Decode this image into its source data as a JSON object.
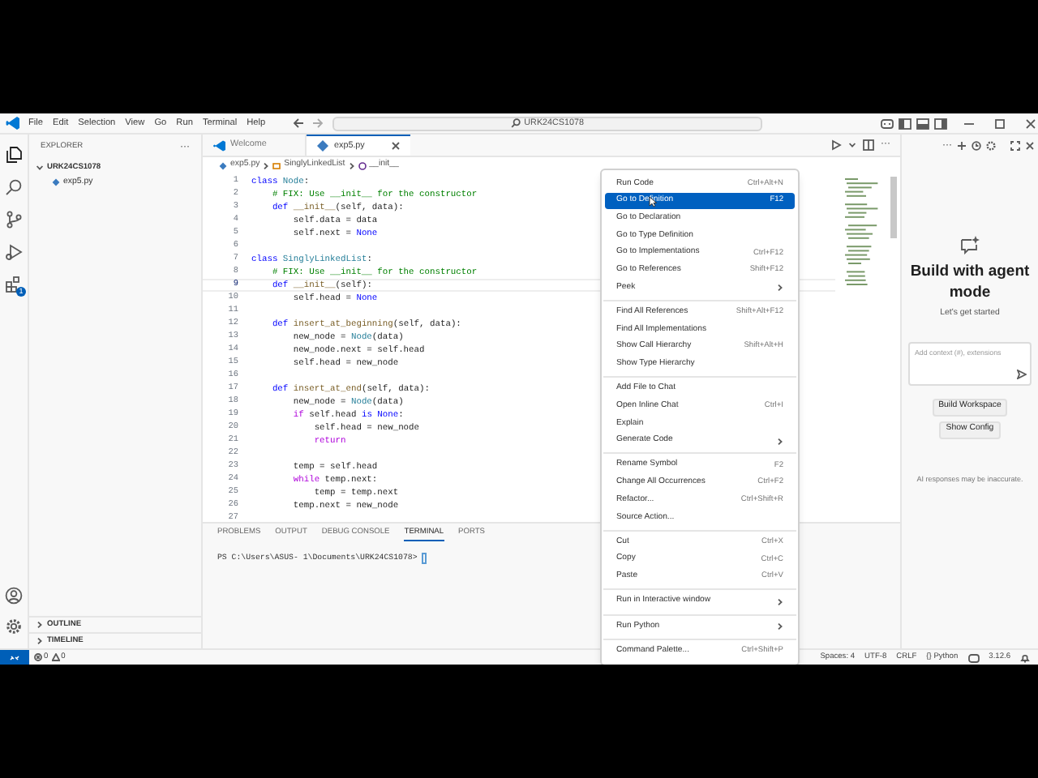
{
  "title_bar": {
    "menus": [
      "File",
      "Edit",
      "Selection",
      "View",
      "Go",
      "Run",
      "Terminal",
      "Help"
    ],
    "search": "URK24CS1078"
  },
  "activity_bar": {
    "extensions_badge": "1"
  },
  "sidebar": {
    "title": "EXPLORER",
    "more": "···",
    "folder": {
      "name": "URK24CS1078",
      "expanded": true,
      "files": [
        {
          "name": "exp5.py"
        }
      ]
    },
    "sections": [
      {
        "name": "OUTLINE",
        "expanded": false
      },
      {
        "name": "TIMELINE",
        "expanded": false
      }
    ]
  },
  "tabs": [
    {
      "label": "Welcome",
      "kind": "welcome",
      "selected": false
    },
    {
      "label": "exp5.py",
      "kind": "python",
      "selected": true
    }
  ],
  "breadcrumb": [
    "exp5.py",
    "SinglyLinkedList",
    "__init__"
  ],
  "editor": {
    "lines": [
      {
        "number": "1",
        "active": false,
        "segments": [
          {
            "kind": "keyword",
            "text": "class"
          },
          {
            "kind": "class",
            "text": " Node"
          },
          {
            "kind": "plain",
            "text": ":"
          }
        ]
      },
      {
        "number": "2",
        "active": false,
        "segments": [
          {
            "kind": "comment",
            "text": "    # FIX: Use __init__ for the constructor"
          }
        ]
      },
      {
        "number": "3",
        "active": false,
        "segments": [
          {
            "kind": "keyword",
            "text": "    def"
          },
          {
            "kind": "function",
            "text": " __init__"
          },
          {
            "kind": "plain",
            "text": "(self, data):"
          }
        ]
      },
      {
        "number": "4",
        "active": false,
        "segments": [
          {
            "kind": "plain",
            "text": "        self.data = data"
          }
        ]
      },
      {
        "number": "5",
        "active": false,
        "segments": [
          {
            "kind": "plain",
            "text": "        self.next = "
          },
          {
            "kind": "constant",
            "text": "None"
          }
        ]
      },
      {
        "number": "6",
        "active": false
      },
      {
        "number": "7",
        "active": false,
        "segments": [
          {
            "kind": "keyword",
            "text": "class"
          },
          {
            "kind": "class",
            "text": " SinglyLinkedList"
          },
          {
            "kind": "plain",
            "text": ":"
          }
        ]
      },
      {
        "number": "8",
        "active": false,
        "segments": [
          {
            "kind": "comment",
            "text": "    # FIX: Use __init__ for the constructor"
          }
        ]
      },
      {
        "number": "9",
        "active": true,
        "segments": [
          {
            "kind": "keyword",
            "text": "    def"
          },
          {
            "kind": "function",
            "text": " __init__"
          },
          {
            "kind": "plain",
            "text": "(self):"
          }
        ]
      },
      {
        "number": "10",
        "active": false,
        "segments": [
          {
            "kind": "plain",
            "text": "        self.head = "
          },
          {
            "kind": "constant",
            "text": "None"
          }
        ]
      },
      {
        "number": "11",
        "active": false
      },
      {
        "number": "12",
        "active": false,
        "segments": [
          {
            "kind": "keyword",
            "text": "    def"
          },
          {
            "kind": "function",
            "text": " insert_at_beginning"
          },
          {
            "kind": "plain",
            "text": "(self, data):"
          }
        ]
      },
      {
        "number": "13",
        "active": false,
        "segments": [
          {
            "kind": "plain",
            "text": "        new_node = "
          },
          {
            "kind": "class",
            "text": "Node"
          },
          {
            "kind": "plain",
            "text": "(data)"
          }
        ]
      },
      {
        "number": "14",
        "active": false,
        "segments": [
          {
            "kind": "plain",
            "text": "        new_node.next = self.head"
          }
        ]
      },
      {
        "number": "15",
        "active": false,
        "segments": [
          {
            "kind": "plain",
            "text": "        self.head = new_node"
          }
        ]
      },
      {
        "number": "16",
        "active": false
      },
      {
        "number": "17",
        "active": false,
        "segments": [
          {
            "kind": "keyword",
            "text": "    def"
          },
          {
            "kind": "function",
            "text": " insert_at_end"
          },
          {
            "kind": "plain",
            "text": "(self, data):"
          }
        ]
      },
      {
        "number": "18",
        "active": false,
        "segments": [
          {
            "kind": "plain",
            "text": "        new_node = "
          },
          {
            "kind": "class",
            "text": "Node"
          },
          {
            "kind": "plain",
            "text": "(data)"
          }
        ]
      },
      {
        "number": "19",
        "active": false,
        "segments": [
          {
            "kind": "control",
            "text": "        if"
          },
          {
            "kind": "plain",
            "text": " self.head "
          },
          {
            "kind": "keyword",
            "text": "is"
          },
          {
            "kind": "constant",
            "text": " None"
          },
          {
            "kind": "plain",
            "text": ":"
          }
        ]
      },
      {
        "number": "20",
        "active": false,
        "segments": [
          {
            "kind": "plain",
            "text": "            self.head = new_node"
          }
        ]
      },
      {
        "number": "21",
        "active": false,
        "segments": [
          {
            "kind": "control",
            "text": "            return"
          }
        ]
      },
      {
        "number": "22",
        "active": false
      },
      {
        "number": "23",
        "active": false,
        "segments": [
          {
            "kind": "plain",
            "text": "        temp = self.head"
          }
        ]
      },
      {
        "number": "24",
        "active": false,
        "segments": [
          {
            "kind": "control",
            "text": "        while"
          },
          {
            "kind": "plain",
            "text": " temp.next:"
          }
        ]
      },
      {
        "number": "25",
        "active": false,
        "segments": [
          {
            "kind": "plain",
            "text": "            temp = temp.next"
          }
        ]
      },
      {
        "number": "26",
        "active": false,
        "segments": [
          {
            "kind": "plain",
            "text": "        temp.next = new_node"
          }
        ]
      },
      {
        "number": "27",
        "active": false
      }
    ]
  },
  "panel": {
    "tabs": [
      {
        "label": "PROBLEMS",
        "selected": false
      },
      {
        "label": "OUTPUT",
        "selected": false
      },
      {
        "label": "DEBUG CONSOLE",
        "selected": false
      },
      {
        "label": "TERMINAL",
        "selected": true
      },
      {
        "label": "PORTS",
        "selected": false
      }
    ],
    "terminal": {
      "prompt": "PS C:\\Users\\ASUS- 1\\Documents\\URK24CS1078> "
    }
  },
  "context_menu": {
    "items": [
      {
        "kind": "item",
        "label": "Run Code",
        "shortcut": "Ctrl+Alt+N",
        "submenu": false,
        "selected": false
      },
      {
        "kind": "item",
        "label": "Go to Definition",
        "shortcut": "F12",
        "submenu": false,
        "selected": true
      },
      {
        "kind": "item",
        "label": "Go to Declaration",
        "submenu": false,
        "selected": false
      },
      {
        "kind": "item",
        "label": "Go to Type Definition",
        "submenu": false,
        "selected": false
      },
      {
        "kind": "item",
        "label": "Go to Implementations",
        "shortcut": "Ctrl+F12",
        "submenu": false,
        "selected": false
      },
      {
        "kind": "item",
        "label": "Go to References",
        "shortcut": "Shift+F12",
        "submenu": false,
        "selected": false
      },
      {
        "kind": "item",
        "label": "Peek",
        "submenu": true,
        "selected": false
      },
      {
        "kind": "separator"
      },
      {
        "kind": "item",
        "label": "Find All References",
        "shortcut": "Shift+Alt+F12",
        "submenu": false,
        "selected": false
      },
      {
        "kind": "item",
        "label": "Find All Implementations",
        "submenu": false,
        "selected": false
      },
      {
        "kind": "item",
        "label": "Show Call Hierarchy",
        "shortcut": "Shift+Alt+H",
        "submenu": false,
        "selected": false
      },
      {
        "kind": "item",
        "label": "Show Type Hierarchy",
        "submenu": false,
        "selected": false
      },
      {
        "kind": "separator"
      },
      {
        "kind": "item",
        "label": "Add File to Chat",
        "submenu": false,
        "selected": false
      },
      {
        "kind": "item",
        "label": "Open Inline Chat",
        "shortcut": "Ctrl+I",
        "submenu": false,
        "selected": false
      },
      {
        "kind": "item",
        "label": "Explain",
        "submenu": false,
        "selected": false
      },
      {
        "kind": "item",
        "label": "Generate Code",
        "submenu": true,
        "selected": false
      },
      {
        "kind": "separator"
      },
      {
        "kind": "item",
        "label": "Rename Symbol",
        "shortcut": "F2",
        "submenu": false,
        "selected": false
      },
      {
        "kind": "item",
        "label": "Change All Occurrences",
        "shortcut": "Ctrl+F2",
        "submenu": false,
        "selected": false
      },
      {
        "kind": "item",
        "label": "Refactor...",
        "shortcut": "Ctrl+Shift+R",
        "submenu": false,
        "selected": false
      },
      {
        "kind": "item",
        "label": "Source Action...",
        "submenu": false,
        "selected": false
      },
      {
        "kind": "separator"
      },
      {
        "kind": "item",
        "label": "Cut",
        "shortcut": "Ctrl+X",
        "submenu": false,
        "selected": false
      },
      {
        "kind": "item",
        "label": "Copy",
        "shortcut": "Ctrl+C",
        "submenu": false,
        "selected": false
      },
      {
        "kind": "item",
        "label": "Paste",
        "shortcut": "Ctrl+V",
        "submenu": false,
        "selected": false
      },
      {
        "kind": "separator"
      },
      {
        "kind": "item",
        "label": "Run in Interactive window",
        "submenu": true,
        "selected": false
      },
      {
        "kind": "separator"
      },
      {
        "kind": "item",
        "label": "Run Python",
        "submenu": true,
        "selected": false
      },
      {
        "kind": "separator"
      },
      {
        "kind": "item",
        "label": "Command Palette...",
        "shortcut": "Ctrl+Shift+P",
        "submenu": false,
        "selected": false
      }
    ]
  },
  "chat": {
    "title": "Build with agent mode",
    "subtitle": "Let's get started",
    "input": {
      "placeholder": "Add context (#), extensions"
    },
    "buttons": [
      "Build Workspace",
      "Show Config"
    ],
    "disclaimer": "AI responses may be inaccurate."
  },
  "status_bar": {
    "errors": "0",
    "warnings": "0",
    "items": [
      "Spaces: 4",
      "UTF-8",
      "CRLF",
      "{} Python"
    ],
    "version": "3.12.6"
  }
}
